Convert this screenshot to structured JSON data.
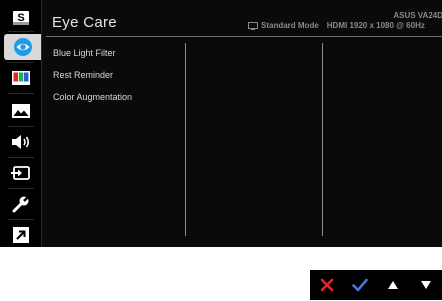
{
  "header": {
    "title": "Eye Care",
    "model": "ASUS VA24D",
    "mode": "Standard Mode",
    "resolution": "HDMI 1920 x 1080 @ 60Hz"
  },
  "sidebar": {
    "items": [
      {
        "icon": "splendid-icon",
        "active": false
      },
      {
        "icon": "eye-care-icon",
        "active": true
      },
      {
        "icon": "color-icon",
        "active": false
      },
      {
        "icon": "image-icon",
        "active": false
      },
      {
        "icon": "sound-icon",
        "active": false
      },
      {
        "icon": "input-select-icon",
        "active": false
      },
      {
        "icon": "system-setup-icon",
        "active": false
      },
      {
        "icon": "shortcut-icon",
        "active": false
      }
    ],
    "splendid_letter": "S"
  },
  "menu": {
    "items": [
      {
        "label": "Blue Light Filter"
      },
      {
        "label": "Rest Reminder"
      },
      {
        "label": "Color Augmentation"
      }
    ]
  },
  "nav": {
    "buttons": [
      {
        "icon": "close-icon",
        "color": "#e8222a"
      },
      {
        "icon": "check-icon",
        "color": "#3d7bd9"
      },
      {
        "icon": "up-arrow-icon",
        "color": "#ffffff"
      },
      {
        "icon": "down-arrow-icon",
        "color": "#ffffff"
      }
    ]
  },
  "colors": {
    "accent": "#1e9be8",
    "background": "#000000",
    "active_tab": "#d9d9d9"
  }
}
